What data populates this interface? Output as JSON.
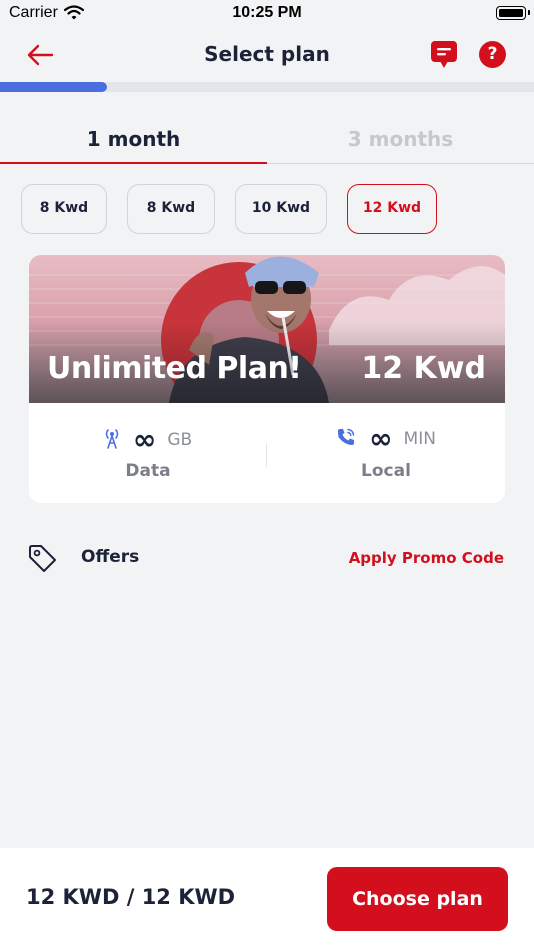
{
  "status_bar": {
    "carrier": "Carrier",
    "time": "10:25 PM"
  },
  "header": {
    "title": "Select plan",
    "back_icon": "arrow-left-icon",
    "chat_icon": "chat-bubble-icon",
    "help_icon": "help-icon",
    "help_glyph": "?"
  },
  "progress": {
    "value": 0.2,
    "color": "#4a6ee0"
  },
  "tabs": [
    {
      "label": "1 month",
      "active": true
    },
    {
      "label": "3 months",
      "active": false
    }
  ],
  "price_options": [
    {
      "label": "8 Kwd",
      "selected": false
    },
    {
      "label": "8 Kwd",
      "selected": false
    },
    {
      "label": "10 Kwd",
      "selected": false
    },
    {
      "label": "12 Kwd",
      "selected": true
    }
  ],
  "plan": {
    "title": "Unlimited Plan!",
    "price": "12 Kwd",
    "features": [
      {
        "icon": "antenna-icon",
        "amount": "∞",
        "unit": "GB",
        "label": "Data"
      },
      {
        "icon": "phone-call-icon",
        "amount": "∞",
        "unit": "MIN",
        "label": "Local"
      }
    ]
  },
  "offers": {
    "label": "Offers",
    "icon": "tag-icon",
    "promo_link": "Apply Promo Code"
  },
  "footer": {
    "total": "12 KWD / 12 KWD",
    "cta_label": "Choose plan"
  },
  "colors": {
    "accent": "#d40f1d",
    "primary_text": "#1c2238",
    "background": "#f2f3f5"
  }
}
